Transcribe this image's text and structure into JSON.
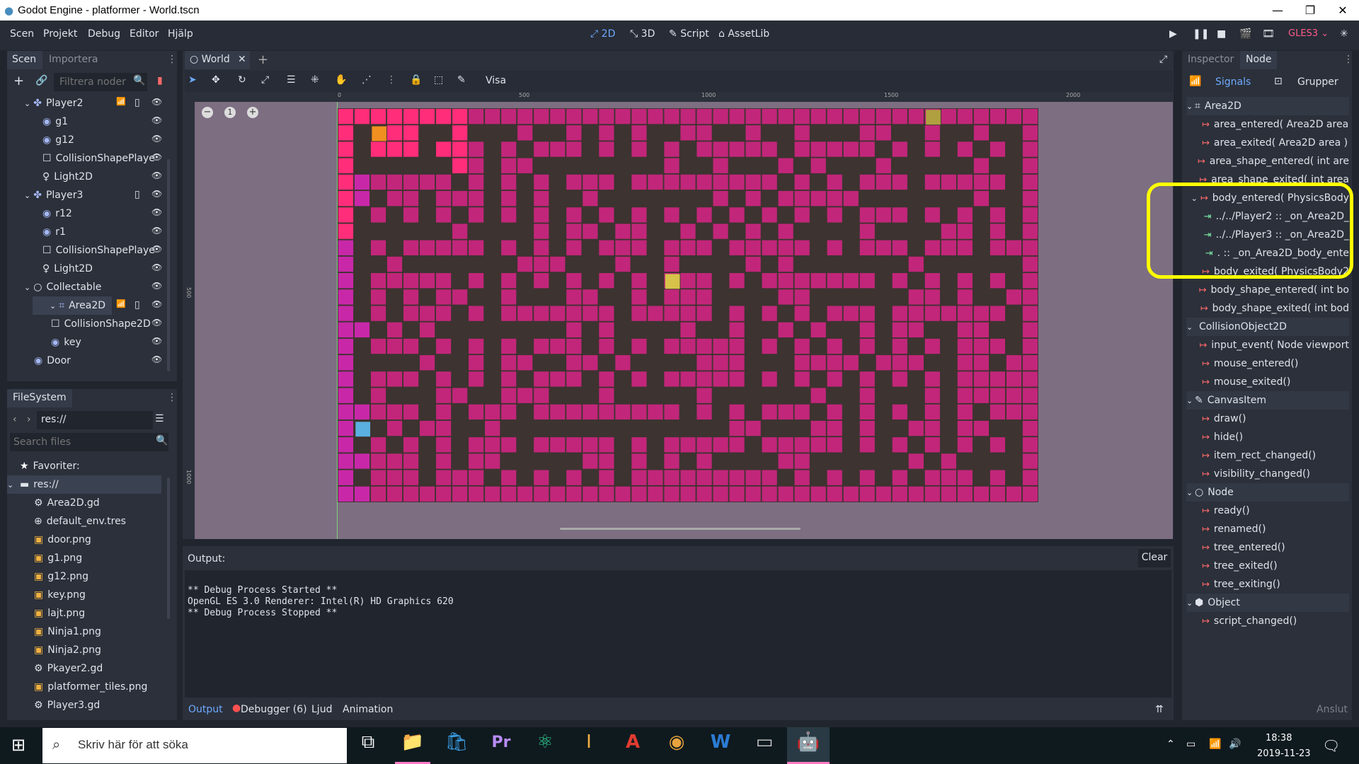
{
  "window": {
    "title": "Godot Engine - platformer - World.tscn"
  },
  "menu": [
    "Scen",
    "Projekt",
    "Debug",
    "Editor",
    "Hjälp"
  ],
  "modes": [
    {
      "label": "2D"
    },
    {
      "label": "3D"
    },
    {
      "label": "Script"
    },
    {
      "label": "AssetLib"
    }
  ],
  "renderer": "GLES3",
  "scene_panel": {
    "tabs": [
      "Scen",
      "Importera"
    ],
    "filter_placeholder": "Filtrera noder",
    "nodes": [
      {
        "label": "Player2",
        "indent": 1,
        "icon": "kinematic-icon",
        "expanded": true
      },
      {
        "label": "g1",
        "indent": 2,
        "icon": "sprite-icon"
      },
      {
        "label": "g12",
        "indent": 2,
        "icon": "sprite-icon"
      },
      {
        "label": "CollisionShapePlaye",
        "indent": 2,
        "icon": "collision-icon"
      },
      {
        "label": "Light2D",
        "indent": 2,
        "icon": "light-icon"
      },
      {
        "label": "Player3",
        "indent": 1,
        "icon": "kinematic-icon",
        "expanded": true
      },
      {
        "label": "r12",
        "indent": 2,
        "icon": "sprite-icon"
      },
      {
        "label": "r1",
        "indent": 2,
        "icon": "sprite-icon"
      },
      {
        "label": "CollisionShapePlaye",
        "indent": 2,
        "icon": "collision-icon"
      },
      {
        "label": "Light2D",
        "indent": 2,
        "icon": "light-icon"
      },
      {
        "label": "Collectable",
        "indent": 1,
        "icon": "node2d-icon",
        "expanded": true
      },
      {
        "label": "Area2D",
        "indent": 2,
        "icon": "area2d-icon",
        "expanded": true
      },
      {
        "label": "CollisionShape2D",
        "indent": 3,
        "icon": "collision-icon"
      },
      {
        "label": "key",
        "indent": 3,
        "icon": "sprite-icon"
      },
      {
        "label": "Door",
        "indent": 1,
        "icon": "sprite-icon"
      }
    ]
  },
  "filesystem": {
    "title": "FileSystem",
    "path": "res://",
    "search_placeholder": "Search files",
    "items": [
      {
        "label": "Favoriter:",
        "icon": "star-icon",
        "indent": 0
      },
      {
        "label": "res://",
        "icon": "folder-icon",
        "indent": 0
      },
      {
        "label": "Area2D.gd",
        "icon": "gear-icon",
        "indent": 1
      },
      {
        "label": "default_env.tres",
        "icon": "globe-icon",
        "indent": 1
      },
      {
        "label": "door.png",
        "icon": "image-icon",
        "indent": 1
      },
      {
        "label": "g1.png",
        "icon": "image-icon",
        "indent": 1
      },
      {
        "label": "g12.png",
        "icon": "image-icon",
        "indent": 1
      },
      {
        "label": "key.png",
        "icon": "image-icon",
        "indent": 1
      },
      {
        "label": "lajt.png",
        "icon": "image-icon",
        "indent": 1
      },
      {
        "label": "Ninja1.png",
        "icon": "image-icon",
        "indent": 1
      },
      {
        "label": "Ninja2.png",
        "icon": "image-icon",
        "indent": 1
      },
      {
        "label": "Pkayer2.gd",
        "icon": "gear-icon",
        "indent": 1
      },
      {
        "label": "platformer_tiles.png",
        "icon": "image-icon",
        "indent": 1
      },
      {
        "label": "Player3.gd",
        "icon": "gear-icon",
        "indent": 1
      }
    ]
  },
  "editor": {
    "tab": "World",
    "visa": "Visa",
    "ruler": [
      "0",
      "500",
      "1000",
      "1500",
      "2000"
    ],
    "vruler": [
      "500",
      "1000"
    ],
    "zoom": "1"
  },
  "output": {
    "label": "Output:",
    "clear": "Clear",
    "lines": [
      "** Debug Process Started **",
      "OpenGL ES 3.0 Renderer: Intel(R) HD Graphics 620",
      "** Debug Process Stopped **"
    ],
    "tabs": [
      "Output",
      "Debugger (6)",
      "Ljud",
      "Animation"
    ]
  },
  "inspector": {
    "tabs": [
      "Inspector",
      "Node"
    ],
    "subtabs": [
      "Signals",
      "Grupper"
    ],
    "connect": "Anslut",
    "rows": [
      {
        "type": "cat",
        "label": "Area2D",
        "icon": "area2d-icon"
      },
      {
        "type": "sig",
        "label": "area_entered( Area2D area"
      },
      {
        "type": "sig",
        "label": "area_exited( Area2D area )"
      },
      {
        "type": "sig",
        "label": "area_shape_entered( int are"
      },
      {
        "type": "sig",
        "label": "area_shape_exited( int area"
      },
      {
        "type": "sig",
        "label": "body_entered( PhysicsBody",
        "expanded": true
      },
      {
        "type": "conn",
        "label": "../../Player2 :: _on_Area2D_"
      },
      {
        "type": "conn",
        "label": "../../Player3 :: _on_Area2D_"
      },
      {
        "type": "conn",
        "label": ". :: _on_Area2D_body_ente"
      },
      {
        "type": "sig",
        "label": "body_exited( PhysicsBody2"
      },
      {
        "type": "sig",
        "label": "body_shape_entered( int bo"
      },
      {
        "type": "sig",
        "label": "body_shape_exited( int bod"
      },
      {
        "type": "cat",
        "label": "CollisionObject2D",
        "icon": ""
      },
      {
        "type": "sig",
        "label": "input_event( Node viewport"
      },
      {
        "type": "sig",
        "label": "mouse_entered()"
      },
      {
        "type": "sig",
        "label": "mouse_exited()"
      },
      {
        "type": "cat",
        "label": "CanvasItem",
        "icon": "pencil-icon"
      },
      {
        "type": "sig",
        "label": "draw()"
      },
      {
        "type": "sig",
        "label": "hide()"
      },
      {
        "type": "sig",
        "label": "item_rect_changed()"
      },
      {
        "type": "sig",
        "label": "visibility_changed()"
      },
      {
        "type": "cat",
        "label": "Node",
        "icon": "node-icon"
      },
      {
        "type": "sig",
        "label": "ready()"
      },
      {
        "type": "sig",
        "label": "renamed()"
      },
      {
        "type": "sig",
        "label": "tree_entered()"
      },
      {
        "type": "sig",
        "label": "tree_exited()"
      },
      {
        "type": "sig",
        "label": "tree_exiting()"
      },
      {
        "type": "cat",
        "label": "Object",
        "icon": "cube-icon"
      },
      {
        "type": "sig",
        "label": "script_changed()"
      }
    ]
  },
  "taskbar": {
    "search_placeholder": "Skriv här för att söka",
    "time": "18:38",
    "date": "2019-11-23"
  },
  "colors": {
    "accent": "#6ea9ff",
    "highlight": "#ffff00",
    "tile": "#c2267a",
    "tile_hot": "#ff2d7a",
    "bg": "#20252e"
  }
}
